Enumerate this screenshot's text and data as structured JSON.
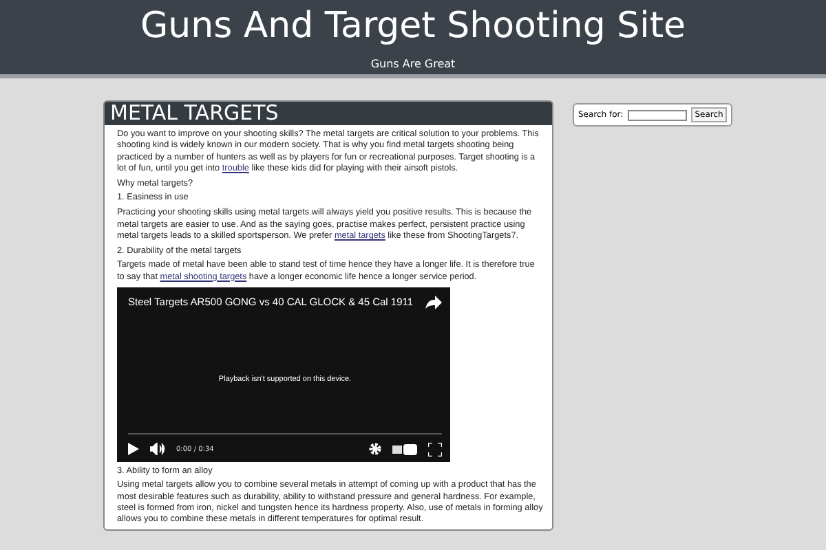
{
  "site": {
    "title": "Guns And Target Shooting Site",
    "tagline": "Guns Are Great"
  },
  "post": {
    "title": "METAL TARGETS",
    "blocks": [
      {
        "kind": "para",
        "parts": [
          {
            "kind": "text",
            "text": "Do you want to improve on your shooting skills? The metal targets are critical solution to your problems. This shooting kind is widely known in our modern society. That is why you find metal targets shooting being practiced by a number of hunters as well as by players for fun or recreational purposes. Target shooting is a lot of fun, until you get into "
          },
          {
            "kind": "link",
            "text": "trouble"
          },
          {
            "kind": "text",
            "text": " like these kids did for playing with their airsoft pistols."
          }
        ]
      },
      {
        "kind": "para",
        "parts": [
          {
            "kind": "text",
            "text": "Why metal targets?"
          }
        ]
      },
      {
        "kind": "para",
        "parts": [
          {
            "kind": "text",
            "text": "1. Easiness in use"
          }
        ]
      },
      {
        "kind": "para",
        "parts": [
          {
            "kind": "text",
            "text": "Practicing your shooting skills using metal targets will always yield you positive results. This is because the metal targets are easier to use. And as the saying goes, practise makes perfect, persistent practice using metal targets leads to a skilled sportsperson. We prefer "
          },
          {
            "kind": "link",
            "text": "metal targets"
          },
          {
            "kind": "text",
            "text": " like these from ShootingTargets7."
          }
        ]
      },
      {
        "kind": "para",
        "parts": [
          {
            "kind": "text",
            "text": "2. Durability of the metal targets"
          }
        ]
      },
      {
        "kind": "para",
        "parts": [
          {
            "kind": "text",
            "text": "Targets made of metal have been able to stand test of time hence they have a longer life. It is therefore true to say that "
          },
          {
            "kind": "link",
            "text": "metal shooting targets"
          },
          {
            "kind": "text",
            "text": " have a longer economic life hence a longer service period."
          }
        ]
      },
      {
        "kind": "video",
        "title": "Steel Targets AR500 GONG vs 40 CAL GLOCK & 45 Cal 1911",
        "message": "Playback isn't supported on this device.",
        "time": "0:00 / 0:34"
      },
      {
        "kind": "para",
        "parts": [
          {
            "kind": "text",
            "text": "3. Ability to form an alloy"
          }
        ]
      },
      {
        "kind": "para",
        "parts": [
          {
            "kind": "text",
            "text": "Using metal targets allow you to combine several metals in attempt of coming up with a product that has the most desirable features such as durability, ability to withstand pressure and general hardness. For example, steel is formed from iron, nickel and tungsten hence its hardness property. Also, use of metals in forming alloy allows you to combine these metals in different temperatures for optimal result."
          }
        ]
      }
    ]
  },
  "search": {
    "label": "Search for:",
    "button": "Search"
  }
}
